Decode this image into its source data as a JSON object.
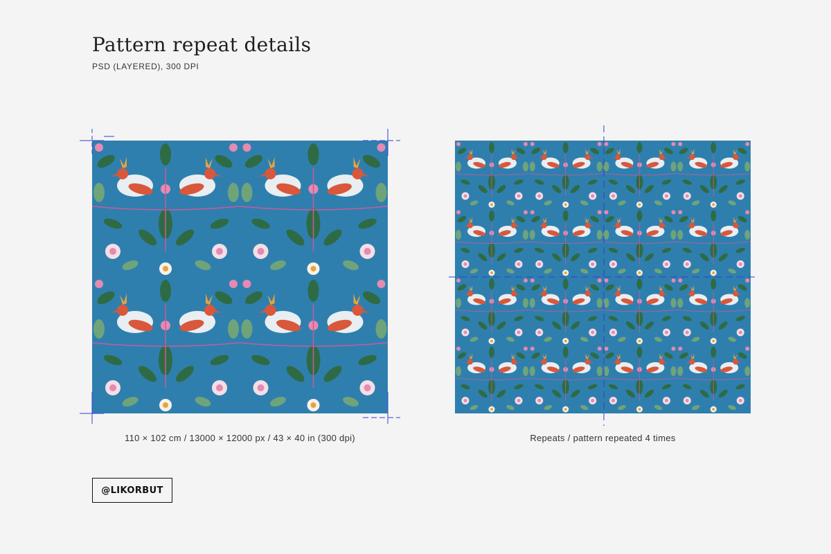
{
  "header": {
    "title": "Pattern repeat details",
    "subtitle": "PSD (LAYERED), 300 DPI"
  },
  "left_panel": {
    "caption": "110 × 102 cm / 13000 × 12000 px / 43 × 40 in (300 dpi)"
  },
  "right_panel": {
    "caption": "Repeats / pattern repeated 4 times"
  },
  "brand": {
    "label": "@LIKORBUT"
  },
  "colors": {
    "background": "#f4f4f4",
    "pattern_blue": "#2f7fae",
    "leaf_green": "#2e6b45",
    "bird_white": "#e8eef2",
    "bird_red": "#d9573b",
    "flower_pink": "#e58ab2",
    "guide_line": "#3a3ad6"
  }
}
